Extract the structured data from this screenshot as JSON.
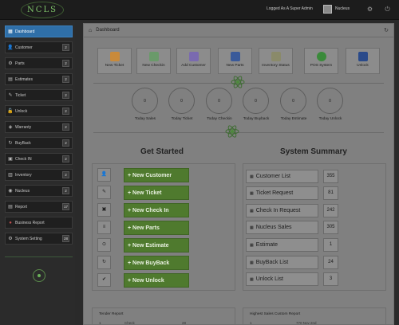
{
  "topbar": {
    "logo_text": "NCLS",
    "logged_in_text": "Logged As A Super Admin",
    "username": "Nucleus"
  },
  "sidebar": {
    "items": [
      {
        "label": "Dashboard",
        "badge": "",
        "icon": "dashboard-icon"
      },
      {
        "label": "Customer",
        "badge": "2",
        "icon": "user-icon"
      },
      {
        "label": "Parts",
        "badge": "2",
        "icon": "gear-icon"
      },
      {
        "label": "Estimates",
        "badge": "2",
        "icon": "calculator-icon"
      },
      {
        "label": "Ticket",
        "badge": "2",
        "icon": "ticket-icon"
      },
      {
        "label": "Unlock",
        "badge": "2",
        "icon": "unlock-icon"
      },
      {
        "label": "Warranty",
        "badge": "2",
        "icon": "shield-icon"
      },
      {
        "label": "BuyBack",
        "badge": "2",
        "icon": "refresh-icon"
      },
      {
        "label": "Check IN",
        "badge": "2",
        "icon": "checkin-icon"
      },
      {
        "label": "Inventory",
        "badge": "2",
        "icon": "inventory-icon"
      },
      {
        "label": "Nucleus",
        "badge": "2",
        "icon": "nucleus-icon"
      },
      {
        "label": "Report",
        "badge": "17",
        "icon": "report-icon"
      },
      {
        "label": "Business Report",
        "badge": "",
        "icon": "business-report-icon"
      },
      {
        "label": "System Setting",
        "badge": "28",
        "icon": "settings-icon"
      }
    ]
  },
  "main": {
    "header_title": "Dashboard",
    "tiles": [
      {
        "label": "New Ticket",
        "icon": "ticket-icon",
        "color": "#c98a3a"
      },
      {
        "label": "New Checkin",
        "icon": "checkin-icon",
        "color": "#6a9a6a"
      },
      {
        "label": "Add Customer",
        "icon": "add-user-icon",
        "color": "#7a6ab0"
      },
      {
        "label": "New Parts",
        "icon": "parts-icon",
        "color": "#3a5a9a"
      },
      {
        "label": "Inventory Status",
        "icon": "inventory-icon",
        "color": "#8a8a6a"
      },
      {
        "label": "POS System",
        "icon": "pos-icon",
        "color": "#3a8a3a"
      },
      {
        "label": "Unlock",
        "icon": "unlock-icon",
        "color": "#2a4a8a"
      }
    ],
    "stats": [
      {
        "value": "0",
        "label": "Today Sales"
      },
      {
        "value": "0",
        "label": "Today Ticket"
      },
      {
        "value": "0",
        "label": "Today Checkin"
      },
      {
        "value": "0",
        "label": "Today Buyback"
      },
      {
        "value": "0",
        "label": "Today Estimate"
      },
      {
        "value": "0",
        "label": "Today Unlock"
      }
    ],
    "get_started": {
      "title": "Get Started",
      "buttons": [
        {
          "label": "+ New Customer",
          "icon": "user-icon"
        },
        {
          "label": "+ New Ticket",
          "icon": "ticket-icon"
        },
        {
          "label": "+ New Check In",
          "icon": "camera-icon"
        },
        {
          "label": "+ New Parts",
          "icon": "list-icon"
        },
        {
          "label": "+ New Estimate",
          "icon": "estimate-icon"
        },
        {
          "label": "+ New BuyBack",
          "icon": "refresh-icon"
        },
        {
          "label": "+ New Unlock",
          "icon": "check-icon"
        }
      ]
    },
    "system_summary": {
      "title": "System Summary",
      "rows": [
        {
          "label": "Customer List",
          "value": "355"
        },
        {
          "label": "Ticket Request",
          "value": "81"
        },
        {
          "label": "Check In Request",
          "value": "242"
        },
        {
          "label": "Nucleus Sales",
          "value": "305"
        },
        {
          "label": "Estimate",
          "value": "1"
        },
        {
          "label": "BuyBack List",
          "value": "24"
        },
        {
          "label": "Unlock List",
          "value": "3"
        }
      ]
    },
    "bottom_left": {
      "title": "Tender Report",
      "row_index": "1",
      "row_text": "Check",
      "row_value": "28"
    },
    "bottom_right": {
      "title": "Highest Sales Custom Report",
      "row_index": "1",
      "row_value": "770 Nov 2nd"
    }
  }
}
